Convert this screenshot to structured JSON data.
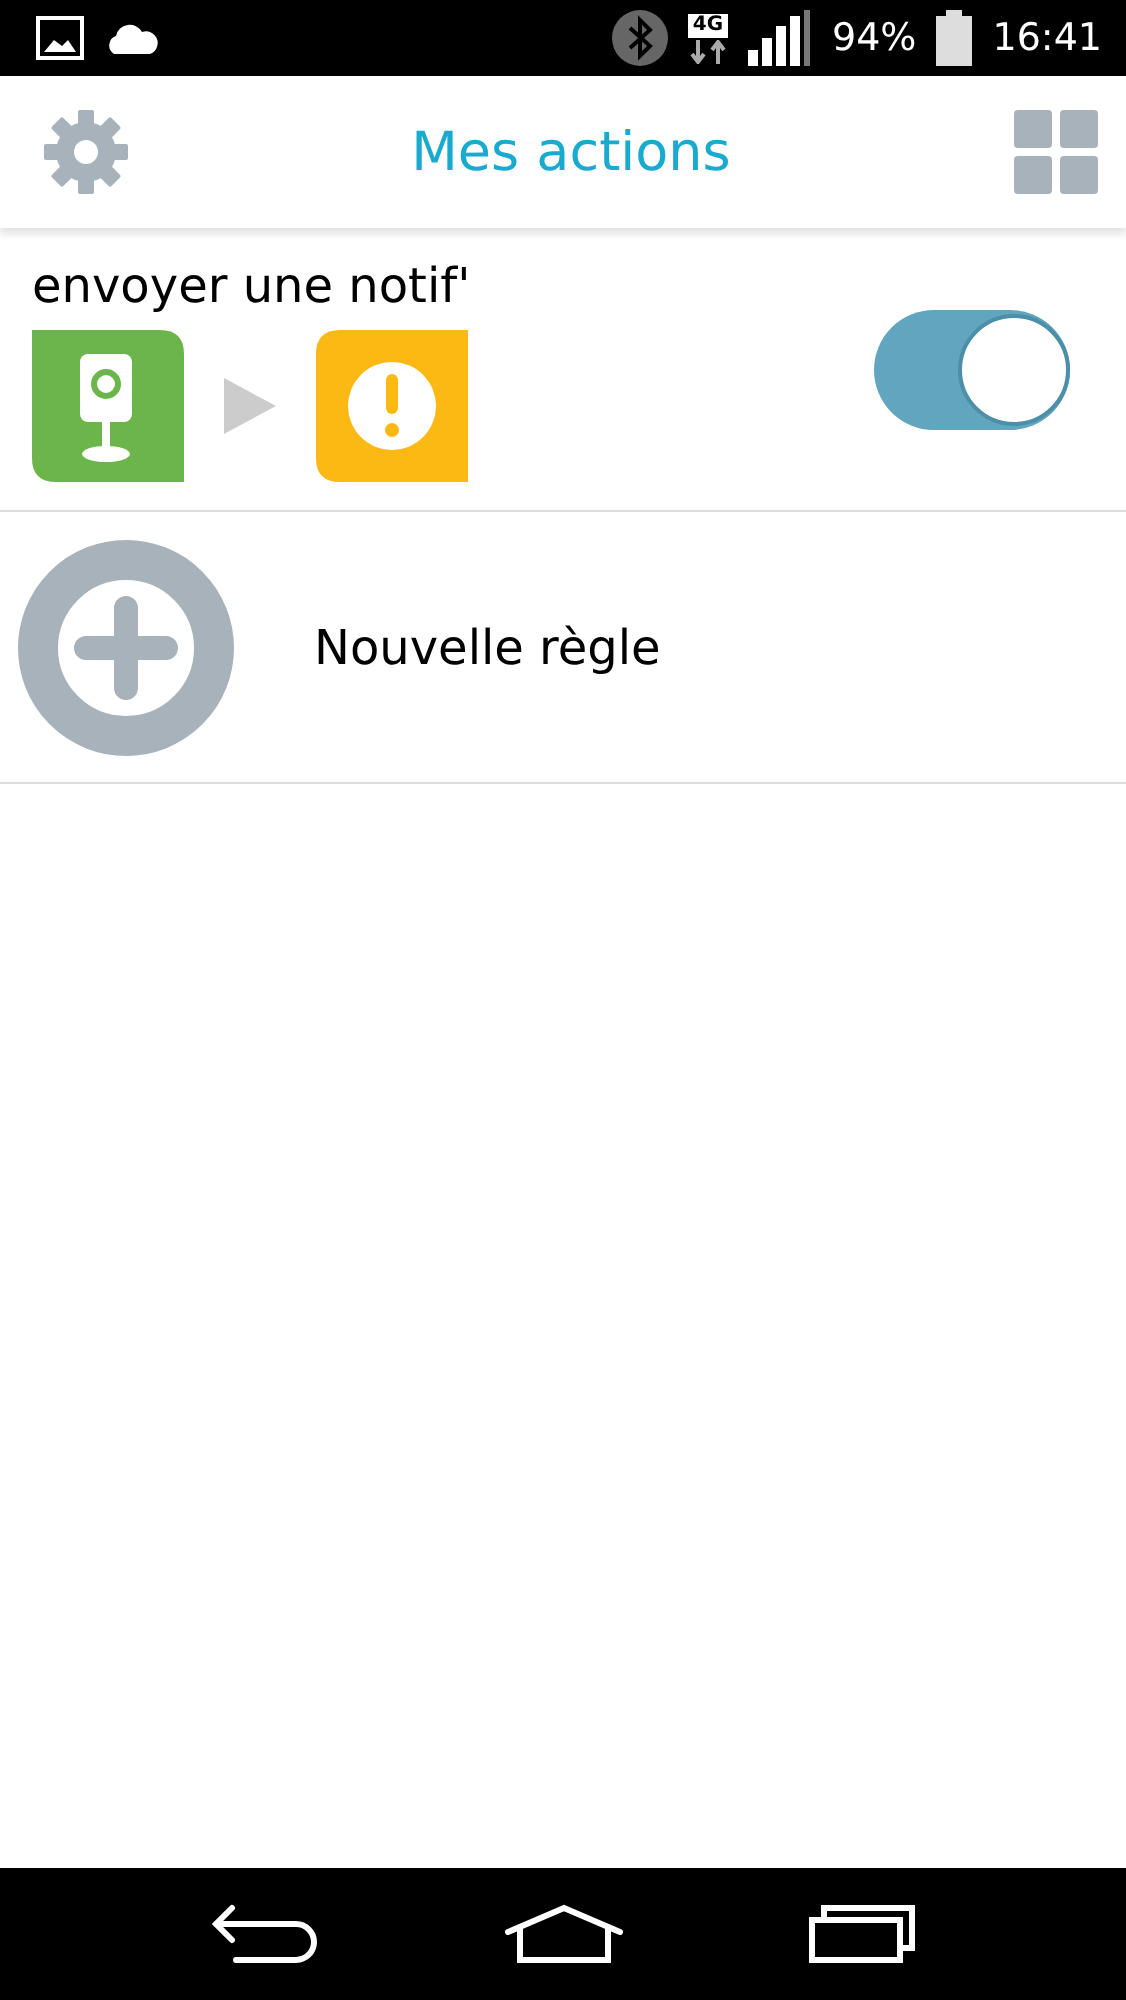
{
  "status_bar": {
    "network": "4G",
    "battery": "94%",
    "time": "16:41"
  },
  "header": {
    "title": "Mes actions"
  },
  "rules": [
    {
      "name": "envoyer une notif'",
      "on": true
    }
  ],
  "new_rule": {
    "label": "Nouvelle règle"
  }
}
